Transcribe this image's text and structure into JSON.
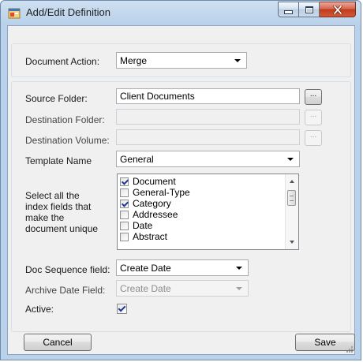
{
  "window": {
    "title": "Add/Edit Definition"
  },
  "document_action": {
    "label": "Document Action:",
    "value": "Merge"
  },
  "source_folder": {
    "label": "Source Folder:",
    "value": "Client Documents",
    "browse_label": "..."
  },
  "destination_folder": {
    "label": "Destination Folder:",
    "value": "",
    "browse_label": "..."
  },
  "destination_volume": {
    "label": "Destination Volume:",
    "value": "",
    "browse_label": "..."
  },
  "template_name": {
    "label": "Template Name",
    "value": "General"
  },
  "index_fields": {
    "label": "Select all the index fields that make the document unique",
    "items": [
      {
        "label": "Document",
        "checked": true
      },
      {
        "label": "General-Type",
        "checked": false
      },
      {
        "label": "Category",
        "checked": true
      },
      {
        "label": "Addressee",
        "checked": false
      },
      {
        "label": "Date",
        "checked": false
      },
      {
        "label": "Abstract",
        "checked": false
      }
    ]
  },
  "doc_sequence": {
    "label": "Doc Sequence field:",
    "value": "Create Date"
  },
  "archive_date": {
    "label": "Archive Date Field:",
    "value": "Create Date"
  },
  "active": {
    "label": "Active:",
    "checked": true
  },
  "buttons": {
    "cancel": "Cancel",
    "save": "Save"
  }
}
